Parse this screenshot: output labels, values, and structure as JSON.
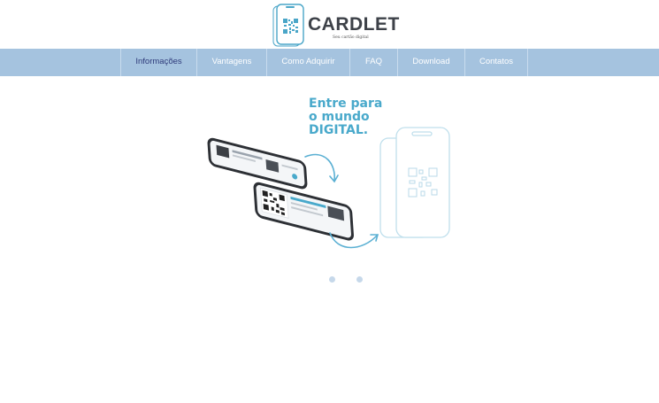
{
  "brand": {
    "name": "CARDLET",
    "tagline": "Seu cartão digital"
  },
  "nav": {
    "items": [
      {
        "label": "Informações"
      },
      {
        "label": "Vantagens"
      },
      {
        "label": "Como Adquirir"
      },
      {
        "label": "FAQ"
      },
      {
        "label": "Download"
      },
      {
        "label": "Contatos"
      }
    ],
    "active_index": 0
  },
  "hero": {
    "slogan_lines": [
      "Entre para",
      "o mundo",
      "DIGITAL."
    ]
  },
  "carousel": {
    "slide_count": 2
  },
  "colors": {
    "nav_bg": "#a5c3df",
    "accent": "#49a9cb",
    "active_text": "#2e3a7a",
    "logo_text": "#3d4148"
  }
}
